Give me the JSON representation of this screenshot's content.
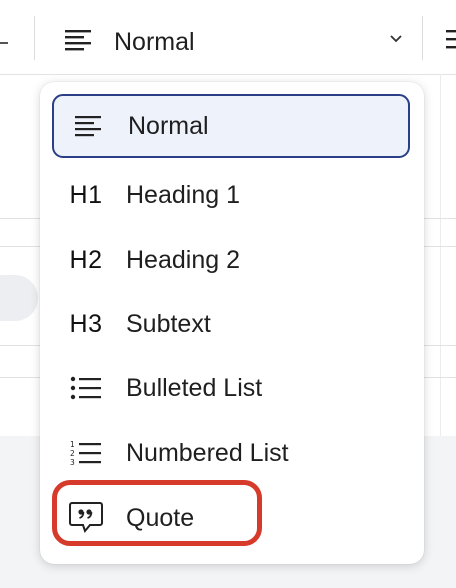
{
  "toolbar": {
    "block_style_value": "Normal"
  },
  "menu": {
    "items": [
      {
        "label": "Normal",
        "icon": "paragraph-lines-icon"
      },
      {
        "label": "Heading 1",
        "icon": "h1-icon",
        "glyph": "H1"
      },
      {
        "label": "Heading 2",
        "icon": "h2-icon",
        "glyph": "H2"
      },
      {
        "label": "Subtext",
        "icon": "h3-icon",
        "glyph": "H3"
      },
      {
        "label": "Bulleted List",
        "icon": "bulleted-list-icon"
      },
      {
        "label": "Numbered List",
        "icon": "numbered-list-icon",
        "numbers": [
          "1",
          "2",
          "3"
        ]
      },
      {
        "label": "Quote",
        "icon": "quote-bubble-icon"
      }
    ],
    "selected_index": 0,
    "highlighted_index": 6
  },
  "colors": {
    "selected_border": "#2a3f86",
    "selected_fill": "#eef3fb",
    "highlight_ring": "#d63a2a",
    "text": "#1f1f1f"
  }
}
